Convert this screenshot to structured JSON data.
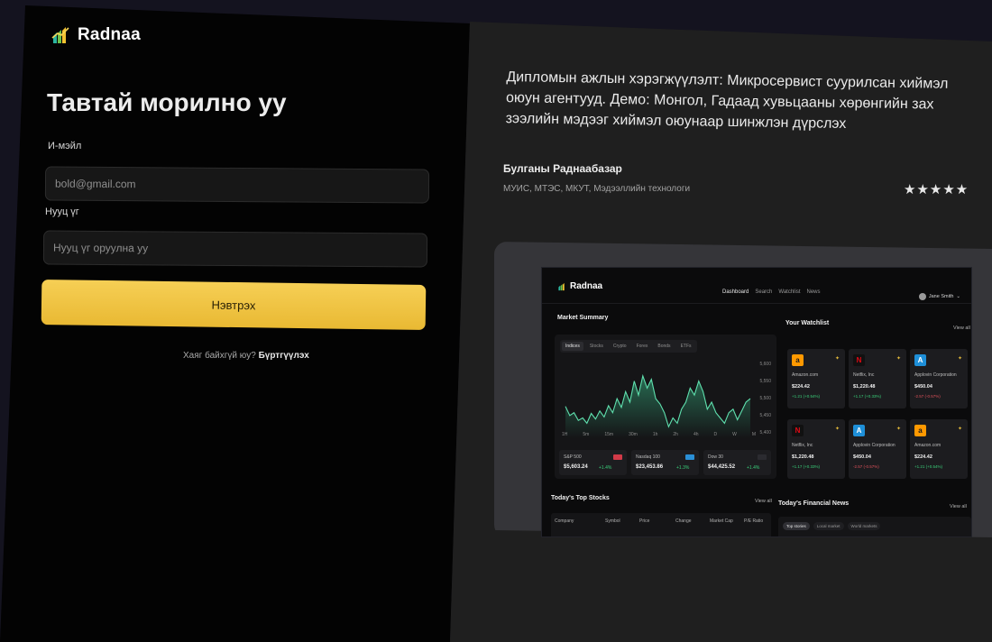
{
  "login": {
    "brand_name": "Radnaa",
    "welcome": "Тавтай морилно уу",
    "email_label": "И-мэйл",
    "email_placeholder": "bold@gmail.com",
    "password_label": "Нууц үг",
    "password_placeholder": "Нууц үг оруулна уу",
    "submit_label": "Нэвтрэх",
    "signup_prompt": "Хаяг байхгүй юу?",
    "signup_link": "Бүртгүүлэх"
  },
  "info": {
    "title": "Дипломын ажлын хэрэгжүүлэлт: Микросервист суурилсан хиймэл оюун агентууд. Демо: Монгол, Гадаад хувьцааны хөрөнгийн зах зээлийн мэдээг хиймэл оюунаар шинжлэн дүрслэх",
    "author": "Булганы Раднаабазар",
    "affiliation": "МУИС, МТЭС, МКУТ, Мэдээллийн технологи",
    "rating_stars": "★★★★★"
  },
  "dashboard": {
    "brand_name": "Radnaa",
    "nav": [
      "Dashboard",
      "Search",
      "Watchlist",
      "News"
    ],
    "user": "Jane Smith",
    "market_title": "Market Summary",
    "tabs": [
      "Indices",
      "Stocks",
      "Crypto",
      "Forex",
      "Bonds",
      "ETFs"
    ],
    "y_ticks": [
      "5,600",
      "5,550",
      "5,500",
      "5,450",
      "5,400"
    ],
    "x_ticks": [
      "1H",
      "5m",
      "15m",
      "30m",
      "1h",
      "2h",
      "4h",
      "D",
      "W",
      "M"
    ],
    "indices": [
      {
        "name": "S&P 500",
        "value": "$5,603.24",
        "change": "+1.4%",
        "tag_color": "#d23a48"
      },
      {
        "name": "Nasdaq 100",
        "value": "$23,453.86",
        "change": "+1.3%",
        "tag_color": "#2a8fd6"
      },
      {
        "name": "Dow 30",
        "value": "$44,425.52",
        "change": "+1.4%",
        "tag_color": "#2b2b30"
      }
    ],
    "watchlist_title": "Your Watchlist",
    "view_all": "View all",
    "watchlist": [
      {
        "logo": "a",
        "name": "Amazon.com",
        "price": "$224.42",
        "change": "+1.21 (+0.54%)",
        "bg": "#ff9900",
        "fg": "#1a1a1a",
        "up": true
      },
      {
        "logo": "N",
        "name": "Netflix, Inc",
        "price": "$1,220.48",
        "change": "+1.17 (+0.33%)",
        "bg": "#111111",
        "fg": "#e50914",
        "up": true
      },
      {
        "logo": "A",
        "name": "Applovin Corporation",
        "price": "$450.04",
        "change": "-2.57 (-0.57%)",
        "bg": "#1e8fd8",
        "fg": "#ffffff",
        "up": false
      },
      {
        "logo": "N",
        "name": "Netflix, Inc",
        "price": "$1,220.48",
        "change": "+1.17 (+0.33%)",
        "bg": "#111111",
        "fg": "#e50914",
        "up": true
      },
      {
        "logo": "A",
        "name": "Applovin Corporation",
        "price": "$450.04",
        "change": "-2.57 (-0.57%)",
        "bg": "#1e8fd8",
        "fg": "#ffffff",
        "up": false
      },
      {
        "logo": "a",
        "name": "Amazon.com",
        "price": "$224.42",
        "change": "+1.21 (+0.54%)",
        "bg": "#ff9900",
        "fg": "#1a1a1a",
        "up": true
      }
    ],
    "top_stocks_title": "Today's Top Stocks",
    "table_headers": [
      "Company",
      "Symbol",
      "Price",
      "Change",
      "Market Cap",
      "P/E Ratio"
    ],
    "news_title": "Today's Financial News",
    "news_tabs": [
      "Top stories",
      "Local market",
      "World markets"
    ],
    "chart_data": {
      "type": "area",
      "values": [
        5488,
        5462,
        5470,
        5448,
        5455,
        5440,
        5468,
        5452,
        5475,
        5458,
        5490,
        5470,
        5510,
        5485,
        5530,
        5500,
        5560,
        5520,
        5575,
        5540,
        5565,
        5510,
        5495,
        5470,
        5430,
        5455,
        5440,
        5480,
        5500,
        5540,
        5520,
        5560,
        5530,
        5480,
        5500,
        5470,
        5455,
        5440,
        5470,
        5480,
        5450,
        5475,
        5500,
        5510
      ],
      "ylim": [
        5400,
        5600
      ]
    }
  },
  "colors": {
    "accent": "#f4c94a",
    "up": "#39d07a",
    "down": "#e0525b"
  }
}
